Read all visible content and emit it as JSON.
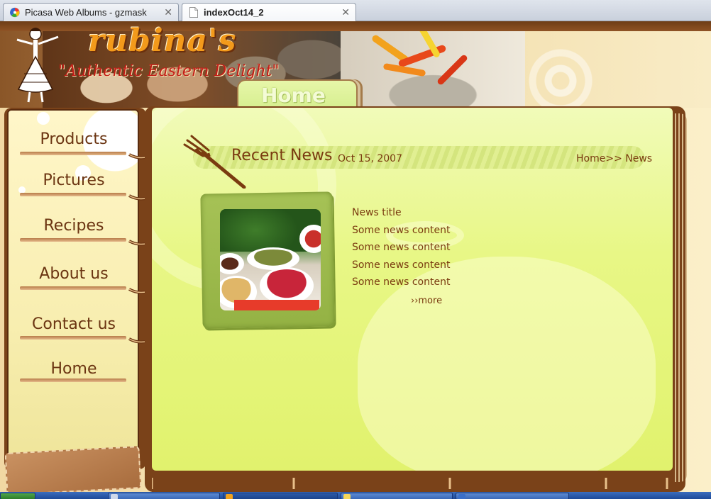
{
  "browser": {
    "tabs": [
      {
        "title": "Picasa Web Albums - gzmask",
        "close": "✕",
        "icon": "picasa-icon"
      },
      {
        "title": "indexOct14_2",
        "close": "✕",
        "icon": "page-icon"
      }
    ]
  },
  "site": {
    "brand": "rubina's",
    "tagline": "\"Authentic Eastern Delight\"",
    "current_tab": "Home",
    "nav": [
      "Products",
      "Pictures",
      "Recipes",
      "About us",
      "Contact us",
      "Home"
    ]
  },
  "news": {
    "heading": "Recent News",
    "date": "Oct 15, 2007",
    "breadcrumb": "Home>> News",
    "item_title": "News title",
    "items": [
      "Some news content",
      "Some news content",
      "Some news content",
      "Some news content"
    ],
    "more": "››more"
  },
  "colors": {
    "brand_orange": "#f39a1b",
    "tagline_red": "#c41d17",
    "text_brown": "#7a3b10",
    "page_green": "#e8f786"
  }
}
